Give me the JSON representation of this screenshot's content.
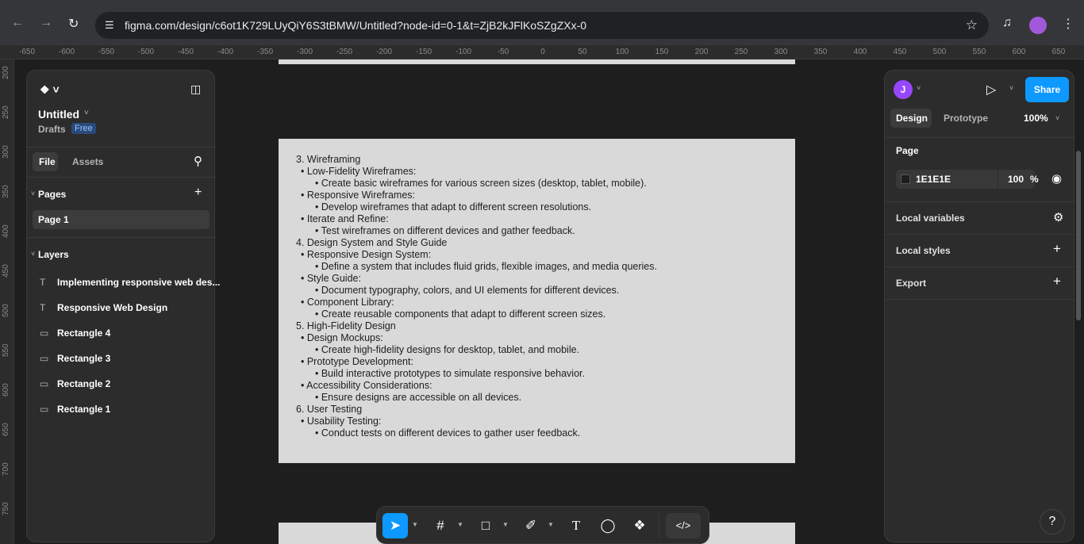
{
  "browser": {
    "url": "figma.com/design/c6ot1K729LUyQiY6S3tBMW/Untitled?node-id=0-1&t=ZjB2kJFlKoSZgZXx-0",
    "icons": [
      "back-arrow-icon",
      "forward-arrow-icon",
      "reload-icon",
      "site-info-icon",
      "star-icon",
      "media-icon",
      "profile-icon",
      "menu-icon"
    ]
  },
  "ruler": {
    "top": [
      "-650",
      "-600",
      "-550",
      "-500",
      "-450",
      "-400",
      "-350",
      "-300",
      "-250",
      "-200",
      "-150",
      "-100",
      "-50",
      "0",
      "50",
      "100",
      "150",
      "200",
      "250",
      "300",
      "350",
      "400",
      "450",
      "500",
      "550",
      "600",
      "650"
    ],
    "left": [
      "200",
      "250",
      "300",
      "350",
      "400",
      "450",
      "500",
      "550",
      "600",
      "650",
      "700",
      "750"
    ]
  },
  "left_panel": {
    "file_name": "Untitled",
    "location": "Drafts",
    "plan_badge": "Free",
    "tabs": {
      "file": "File",
      "assets": "Assets"
    },
    "pages_header": "Pages",
    "pages": [
      "Page 1"
    ],
    "layers_header": "Layers",
    "layers": [
      {
        "name": "Implementing responsive web des...",
        "icon": "text-icon"
      },
      {
        "name": "Responsive Web Design",
        "icon": "text-icon"
      },
      {
        "name": "Rectangle 4",
        "icon": "rectangle-icon"
      },
      {
        "name": "Rectangle 3",
        "icon": "rectangle-icon"
      },
      {
        "name": "Rectangle 2",
        "icon": "rectangle-icon"
      },
      {
        "name": "Rectangle 1",
        "icon": "rectangle-icon"
      }
    ]
  },
  "right_panel": {
    "avatar_letter": "J",
    "share_label": "Share",
    "tabs": {
      "design": "Design",
      "prototype": "Prototype"
    },
    "zoom": "100%",
    "page_section": "Page",
    "bg_color": "1E1E1E",
    "bg_opacity": "100",
    "percent_sign": "%",
    "local_variables": "Local variables",
    "local_styles": "Local styles",
    "export": "Export"
  },
  "canvas_text": [
    {
      "level": 0,
      "text": "3. Wireframing"
    },
    {
      "level": 1,
      "text": "• Low-Fidelity Wireframes:"
    },
    {
      "level": 2,
      "text": "• Create basic wireframes for various screen sizes (desktop, tablet, mobile)."
    },
    {
      "level": 1,
      "text": "• Responsive Wireframes:"
    },
    {
      "level": 2,
      "text": "• Develop wireframes that adapt to different screen resolutions."
    },
    {
      "level": 1,
      "text": "• Iterate and Refine:"
    },
    {
      "level": 2,
      "text": "• Test wireframes on different devices and gather feedback."
    },
    {
      "level": 0,
      "text": "4. Design System and Style Guide"
    },
    {
      "level": 1,
      "text": "• Responsive Design System:"
    },
    {
      "level": 2,
      "text": "• Define a system that includes fluid grids, flexible images, and media queries."
    },
    {
      "level": 1,
      "text": "• Style Guide:"
    },
    {
      "level": 2,
      "text": "• Document typography, colors, and UI elements for different devices."
    },
    {
      "level": 1,
      "text": "• Component Library:"
    },
    {
      "level": 2,
      "text": "• Create reusable components that adapt to different screen sizes."
    },
    {
      "level": 0,
      "text": "5. High-Fidelity Design"
    },
    {
      "level": 1,
      "text": "• Design Mockups:"
    },
    {
      "level": 2,
      "text": "• Create high-fidelity designs for desktop, tablet, and mobile."
    },
    {
      "level": 1,
      "text": "• Prototype Development:"
    },
    {
      "level": 2,
      "text": "• Build interactive prototypes to simulate responsive behavior."
    },
    {
      "level": 1,
      "text": "• Accessibility Considerations:"
    },
    {
      "level": 2,
      "text": "• Ensure designs are accessible on all devices."
    },
    {
      "level": 0,
      "text": "6. User Testing"
    },
    {
      "level": 1,
      "text": "• Usability Testing:"
    },
    {
      "level": 2,
      "text": "• Conduct tests on different devices to gather user feedback."
    }
  ],
  "toolbar": {
    "tools": [
      "move-tool-icon",
      "frame-tool-icon",
      "rectangle-tool-icon",
      "pen-tool-icon",
      "text-tool-icon",
      "comment-tool-icon",
      "actions-tool-icon",
      "dev-mode-icon"
    ]
  },
  "help_label": "?",
  "colors": {
    "accent": "#0d99ff",
    "panel": "#2c2c2c",
    "canvas": "#1e1e1e",
    "frame": "#d9d9d9"
  }
}
